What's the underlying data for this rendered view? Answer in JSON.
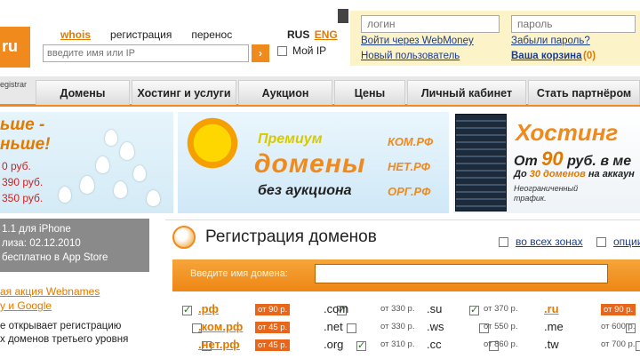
{
  "logo": {
    "text": "ru"
  },
  "nav": {
    "whois": "whois",
    "registration": "регистрация",
    "transfer": "перенос"
  },
  "search": {
    "placeholder": "введите имя или IP",
    "go": "›"
  },
  "lang": {
    "rus": "RUS",
    "eng": "ENG"
  },
  "myip": {
    "label": "Мой IP"
  },
  "login": {
    "login_placeholder": "логин",
    "password_placeholder": "пароль",
    "webmoney": "Войти через WebMoney",
    "new_user": "Новый пользователь",
    "forgot": "Забыли пароль?",
    "cart": "Ваша корзина",
    "cart_count": "(0)"
  },
  "menu": {
    "registrar": "egistrar",
    "tabs": [
      "Домены",
      "Хостинг и услуги",
      "Аукцион",
      "Цены",
      "Личный кабинет",
      "Стать партнёром"
    ]
  },
  "banner_left": {
    "title1": "ьше -",
    "title2": "ньше!",
    "prices": [
      "0 руб.",
      "390 руб.",
      "350 руб."
    ]
  },
  "banner_mid": {
    "premium": "Премиум",
    "domains": "домены",
    "no_auction": "без аукциона",
    "zones": [
      "КОМ.РФ",
      "НЕТ.РФ",
      "ОРГ.РФ"
    ]
  },
  "banner_right": {
    "hosting": "Хостинг",
    "from": "От",
    "price": "90",
    "unit": "руб. в ме",
    "domains_a": "До",
    "domains_hl": "30 доменов",
    "domains_b": "на аккаун",
    "traffic1": "Неограниченный",
    "traffic2": "трафик."
  },
  "news": {
    "lines": [
      "1.1 для iPhone",
      "лиза: 02.12.2010",
      "бесплатно в App Store"
    ]
  },
  "promo": {
    "line1": "ая акция Webnames",
    "line2": "у и Google",
    "line3": "е открывает регистрацию",
    "line4": "х доменов третьего уровня"
  },
  "main": {
    "title": "Регистрация доменов",
    "all_zones": "во всех зонах",
    "options": "опции",
    "domain_label": "Введите имя домена:"
  },
  "zones": [
    {
      "name": ".рф",
      "price": "от 90 р.",
      "hot": true,
      "checked": true,
      "col": 0,
      "row": 0
    },
    {
      "name": ".ком.рф",
      "price": "от 45 р.",
      "hot": true,
      "checked": false,
      "col": 0,
      "row": 1
    },
    {
      "name": ".нет.рф",
      "price": "от 45 р.",
      "hot": true,
      "checked": false,
      "col": 0,
      "row": 2
    },
    {
      "name": ".com",
      "price": "от 330 р.",
      "hot": false,
      "checked": true,
      "col": 1,
      "row": 0
    },
    {
      "name": ".net",
      "price": "от 330 р.",
      "hot": false,
      "checked": false,
      "col": 1,
      "row": 1
    },
    {
      "name": ".org",
      "price": "от 310 р.",
      "hot": false,
      "checked": true,
      "col": 1,
      "row": 2
    },
    {
      "name": ".su",
      "price": "от 370 р.",
      "hot": false,
      "checked": true,
      "col": 2,
      "row": 0
    },
    {
      "name": ".ws",
      "price": "от 550 р.",
      "hot": false,
      "checked": false,
      "col": 2,
      "row": 1
    },
    {
      "name": ".cc",
      "price": "от 860 р.",
      "hot": false,
      "checked": false,
      "col": 2,
      "row": 2
    },
    {
      "name": ".ru",
      "price": "от 90 р.",
      "hot": true,
      "checked": true,
      "col": 3,
      "row": 0
    },
    {
      "name": ".me",
      "price": "от 600 р.",
      "hot": false,
      "checked": false,
      "col": 3,
      "row": 1
    },
    {
      "name": ".tw",
      "price": "от 700 р.",
      "hot": false,
      "checked": false,
      "col": 3,
      "row": 2
    }
  ]
}
